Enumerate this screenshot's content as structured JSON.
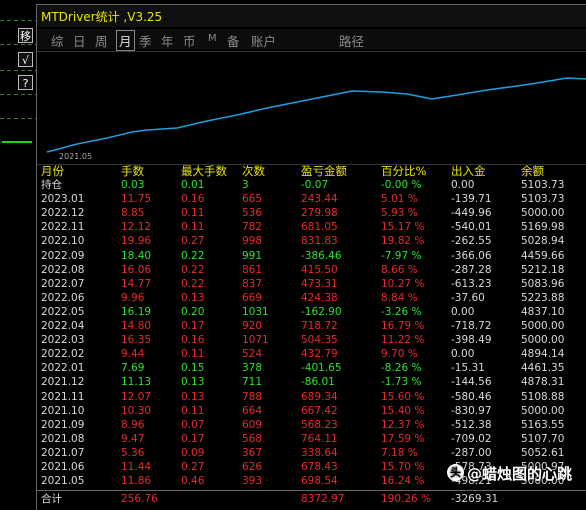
{
  "window_title": "MTDriver统计 ,V3.25",
  "side_buttons": [
    "移",
    "√",
    "?"
  ],
  "tabs": [
    "综",
    "日",
    "周",
    "月",
    "季",
    "年",
    "币",
    "M",
    "备",
    "账户",
    "路径"
  ],
  "active_tab": "月",
  "chart": {
    "x_start_label": "2021.05",
    "line_color": "#1e9fe0"
  },
  "headers": [
    "月份",
    "手数",
    "最大手数",
    "次数",
    "盈亏金额",
    "百分比%",
    "出入金",
    "余额"
  ],
  "rows": [
    {
      "cells": [
        "持仓",
        "0.03",
        "0.01",
        "3",
        "-0.07",
        "-0.00 %",
        "0.00",
        "5103.73"
      ],
      "color": "green"
    },
    {
      "cells": [
        "2023.01",
        "11.75",
        "0.16",
        "665",
        "243.44",
        "5.01 %",
        "-139.71",
        "5103.73"
      ],
      "color": "red"
    },
    {
      "cells": [
        "2022.12",
        "8.85",
        "0.11",
        "536",
        "279.98",
        "5.93 %",
        "-449.96",
        "5000.00"
      ],
      "color": "red"
    },
    {
      "cells": [
        "2022.11",
        "12.12",
        "0.11",
        "782",
        "681.05",
        "15.17 %",
        "-540.01",
        "5169.98"
      ],
      "color": "red"
    },
    {
      "cells": [
        "2022.10",
        "19.96",
        "0.27",
        "998",
        "831.83",
        "19.82 %",
        "-262.55",
        "5028.94"
      ],
      "color": "red"
    },
    {
      "cells": [
        "2022.09",
        "18.40",
        "0.22",
        "991",
        "-386.46",
        "-7.97 %",
        "-366.06",
        "4459.66"
      ],
      "color": "green"
    },
    {
      "cells": [
        "2022.08",
        "16.06",
        "0.22",
        "861",
        "415.50",
        "8.66 %",
        "-287.28",
        "5212.18"
      ],
      "color": "red"
    },
    {
      "cells": [
        "2022.07",
        "14.77",
        "0.22",
        "837",
        "473.31",
        "10.27 %",
        "-613.23",
        "5083.96"
      ],
      "color": "red"
    },
    {
      "cells": [
        "2022.06",
        "9.96",
        "0.13",
        "669",
        "424.38",
        "8.84 %",
        "-37.60",
        "5223.88"
      ],
      "color": "red"
    },
    {
      "cells": [
        "2022.05",
        "16.19",
        "0.20",
        "1031",
        "-162.90",
        "-3.26 %",
        "0.00",
        "4837.10"
      ],
      "color": "green"
    },
    {
      "cells": [
        "2022.04",
        "14.80",
        "0.17",
        "920",
        "718.72",
        "16.79 %",
        "-718.72",
        "5000.00"
      ],
      "color": "red"
    },
    {
      "cells": [
        "2022.03",
        "16.35",
        "0.16",
        "1071",
        "504.35",
        "11.22 %",
        "-398.49",
        "5000.00"
      ],
      "color": "red"
    },
    {
      "cells": [
        "2022.02",
        "9.44",
        "0.11",
        "524",
        "432.79",
        "9.70 %",
        "0.00",
        "4894.14"
      ],
      "color": "red"
    },
    {
      "cells": [
        "2022.01",
        "7.69",
        "0.15",
        "378",
        "-401.65",
        "-8.26 %",
        "-15.31",
        "4461.35"
      ],
      "color": "green"
    },
    {
      "cells": [
        "2021.12",
        "11.13",
        "0.13",
        "711",
        "-86.01",
        "-1.73 %",
        "-144.56",
        "4878.31"
      ],
      "color": "green"
    },
    {
      "cells": [
        "2021.11",
        "12.07",
        "0.13",
        "788",
        "689.34",
        "15.60 %",
        "-580.46",
        "5108.88"
      ],
      "color": "red"
    },
    {
      "cells": [
        "2021.10",
        "10.30",
        "0.11",
        "664",
        "667.42",
        "15.40 %",
        "-830.97",
        "5000.00"
      ],
      "color": "red"
    },
    {
      "cells": [
        "2021.09",
        "8.96",
        "0.07",
        "609",
        "568.23",
        "12.37 %",
        "-512.38",
        "5163.55"
      ],
      "color": "red"
    },
    {
      "cells": [
        "2021.08",
        "9.47",
        "0.17",
        "568",
        "764.11",
        "17.59 %",
        "-709.02",
        "5107.70"
      ],
      "color": "red"
    },
    {
      "cells": [
        "2021.07",
        "5.36",
        "0.09",
        "367",
        "338.64",
        "7.18 %",
        "-287.00",
        "5052.61"
      ],
      "color": "red"
    },
    {
      "cells": [
        "2021.06",
        "11.44",
        "0.27",
        "626",
        "678.43",
        "15.70 %",
        "-578.73",
        "5000.97"
      ],
      "color": "red"
    },
    {
      "cells": [
        "2021.05",
        "11.86",
        "0.46",
        "393",
        "698.54",
        "16.24 %",
        "-498.21",
        "5000.00"
      ],
      "color": "red"
    }
  ],
  "total": {
    "label": "合计",
    "lots": "256.76",
    "profit": "8372.97",
    "percent": "190.26 %",
    "deposits": "-3269.31"
  },
  "watermark": "@蜡烛图的心跳"
}
